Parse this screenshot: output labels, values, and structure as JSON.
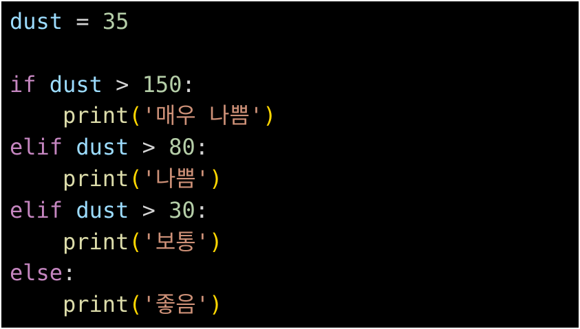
{
  "code": {
    "line1": {
      "var": "dust",
      "op": " = ",
      "num": "35"
    },
    "line3": {
      "kw": "if",
      "var": " dust",
      "op": " > ",
      "num": "150",
      "colon": ":"
    },
    "line4": {
      "fn": "print",
      "open": "(",
      "str": "'매우 나쁨'",
      "close": ")"
    },
    "line5": {
      "kw": "elif",
      "var": " dust",
      "op": " > ",
      "num": "80",
      "colon": ":"
    },
    "line6": {
      "fn": "print",
      "open": "(",
      "str": "'나쁨'",
      "close": ")"
    },
    "line7": {
      "kw": "elif",
      "var": " dust",
      "op": " > ",
      "num": "30",
      "colon": ":"
    },
    "line8": {
      "fn": "print",
      "open": "(",
      "str": "'보통'",
      "close": ")"
    },
    "line9": {
      "kw": "else",
      "colon": ":"
    },
    "line10": {
      "fn": "print",
      "open": "(",
      "str": "'좋음'",
      "close": ")"
    }
  }
}
